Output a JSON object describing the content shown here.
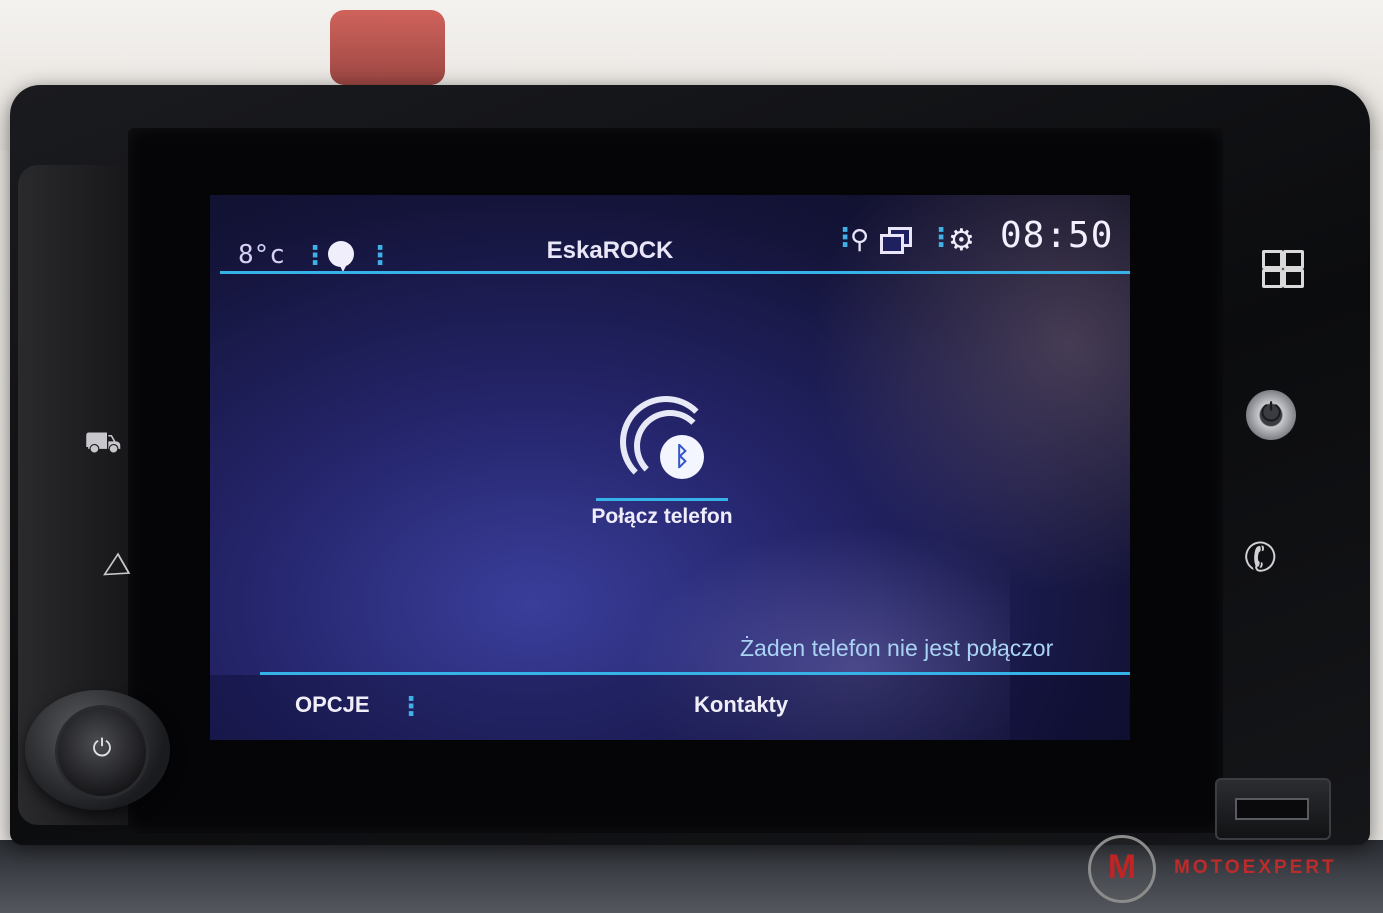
{
  "status_bar": {
    "temperature": "8°c",
    "station": "EskaROCK",
    "clock": "08:50"
  },
  "main": {
    "connect_label": "Połącz telefon",
    "no_phone_message": "Żaden telefon nie jest połączor"
  },
  "bottom_bar": {
    "options_label": "OPCJE",
    "contacts_label": "Kontakty"
  },
  "icons": {
    "bluetooth": "bluetooth-icon",
    "settings": "settings-icon",
    "phone": "phone-icon",
    "apps": "apps-grid-icon",
    "car": "car-icon",
    "navigation": "navigation-icon",
    "power": "power-icon",
    "location": "location-pin-icon",
    "windows": "multi-window-icon",
    "gears": "gears-icon"
  },
  "watermark": {
    "logo_letter": "M",
    "logo_text": "MOTOEXPERT"
  },
  "colors": {
    "accent": "#35b3e8",
    "screen_bg": "#1c1d5a",
    "watermark_red": "#bf2a2a"
  }
}
